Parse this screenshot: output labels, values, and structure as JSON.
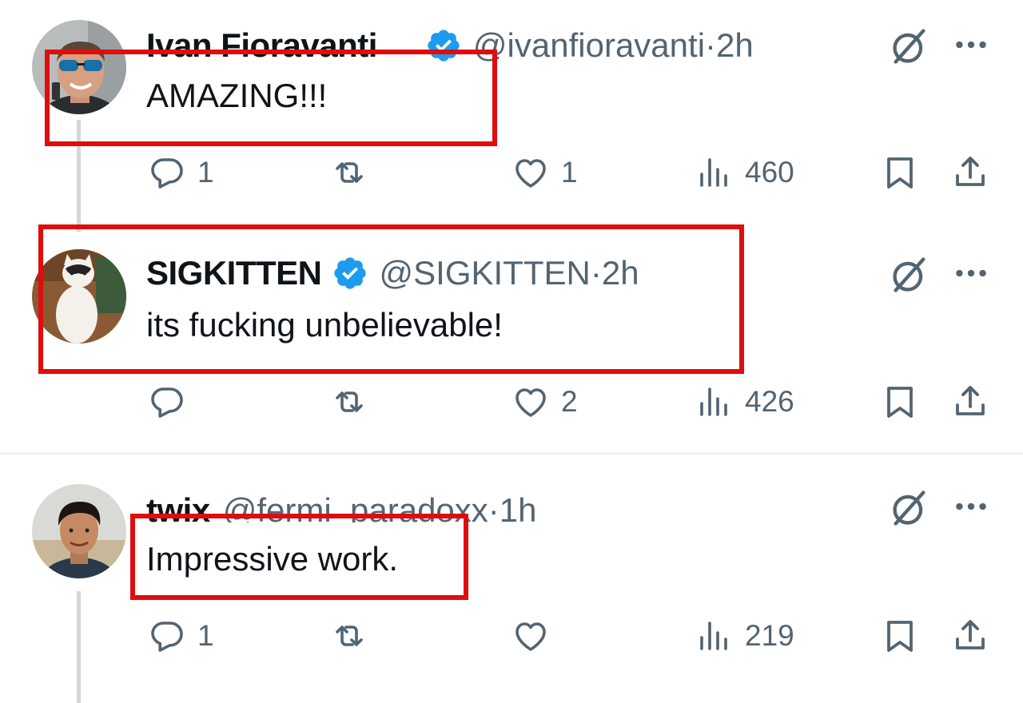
{
  "tweets": [
    {
      "display_name": "Ivan Fioravanti",
      "handle": "@ivanfioravanti",
      "time": "2h",
      "text": "AMAZING!!!",
      "replies": "1",
      "reposts": "",
      "likes": "1",
      "views": "460"
    },
    {
      "display_name": "SIGKITTEN",
      "handle": "@SIGKITTEN",
      "time": "2h",
      "text": "its fucking unbelievable!",
      "replies": "",
      "reposts": "",
      "likes": "2",
      "views": "426"
    },
    {
      "display_name": "twix",
      "handle": "@fermi_paradoxx",
      "time": "1h",
      "text": "Impressive work.",
      "replies": "1",
      "reposts": "",
      "likes": "",
      "views": "219"
    }
  ],
  "separator": "·",
  "colors": {
    "highlight_box": "#e00d0d",
    "verified_badge": "#1d9bf0",
    "secondary_text": "#536471",
    "primary_text": "#0f1419"
  },
  "icons": [
    "reply-icon",
    "repost-icon",
    "like-icon",
    "views-icon",
    "bookmark-icon",
    "share-icon",
    "grok-icon",
    "more-icon",
    "verified-badge-icon"
  ]
}
